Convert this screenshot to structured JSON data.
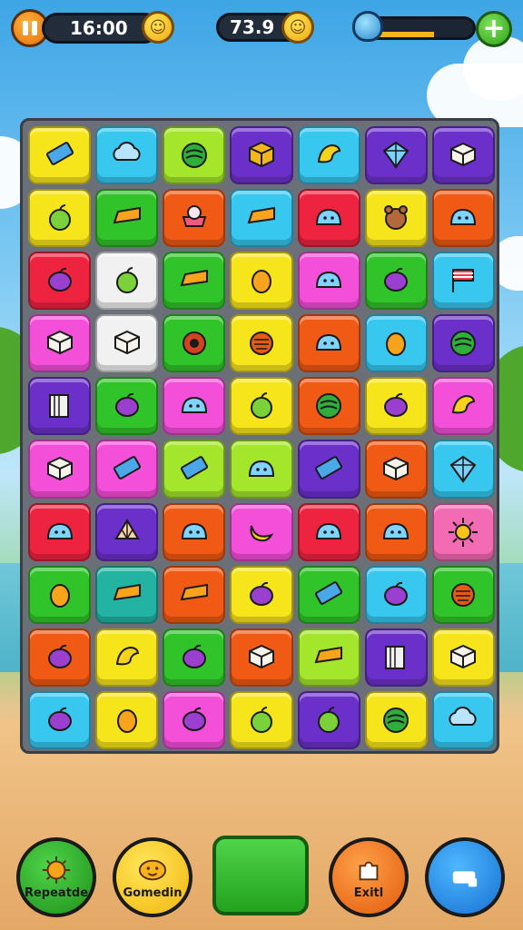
{
  "hud": {
    "time": "16:00",
    "score": "73.9",
    "progress_fraction": 0.62,
    "add_label": "+"
  },
  "colors": {
    "red": "#ee2340",
    "orange": "#f05a14",
    "yellow": "#f7e51b",
    "lime": "#a3e62b",
    "green": "#31c42a",
    "cyan": "#38c7ee",
    "purple": "#6b30c9",
    "magenta": "#f34fd9",
    "pink": "#f26bb3",
    "teal": "#22b3a2",
    "white": "#f1f1f1",
    "pale": "#fbe48a"
  },
  "board": {
    "rows": [
      [
        {
          "bg": "yellow",
          "icon": "chip-icon"
        },
        {
          "bg": "cyan",
          "icon": "cloud-icon"
        },
        {
          "bg": "lime",
          "icon": "melon-icon"
        },
        {
          "bg": "purple",
          "icon": "cube-icon"
        },
        {
          "bg": "cyan",
          "icon": "bird-icon"
        },
        {
          "bg": "purple",
          "icon": "crystal-icon"
        },
        {
          "bg": "purple",
          "icon": "box-icon"
        }
      ],
      [
        {
          "bg": "yellow",
          "icon": "apple-icon"
        },
        {
          "bg": "green",
          "icon": "cheese-icon"
        },
        {
          "bg": "orange",
          "icon": "cake-icon"
        },
        {
          "bg": "cyan",
          "icon": "cheese-icon"
        },
        {
          "bg": "red",
          "icon": "slime-icon"
        },
        {
          "bg": "yellow",
          "icon": "bear-icon"
        },
        {
          "bg": "orange",
          "icon": "slime-icon"
        }
      ],
      [
        {
          "bg": "red",
          "icon": "plum-icon"
        },
        {
          "bg": "white",
          "icon": "apple-icon"
        },
        {
          "bg": "green",
          "icon": "cheese-icon"
        },
        {
          "bg": "yellow",
          "icon": "lemon-icon"
        },
        {
          "bg": "magenta",
          "icon": "slime-icon"
        },
        {
          "bg": "green",
          "icon": "plum-icon"
        },
        {
          "bg": "cyan",
          "icon": "flag-icon"
        }
      ],
      [
        {
          "bg": "magenta",
          "icon": "box-icon"
        },
        {
          "bg": "white",
          "icon": "box-icon"
        },
        {
          "bg": "green",
          "icon": "seed-icon"
        },
        {
          "bg": "yellow",
          "icon": "berry-icon"
        },
        {
          "bg": "orange",
          "icon": "slime-icon"
        },
        {
          "bg": "cyan",
          "icon": "lemon-icon"
        },
        {
          "bg": "purple",
          "icon": "melon-icon"
        }
      ],
      [
        {
          "bg": "purple",
          "icon": "book-icon"
        },
        {
          "bg": "green",
          "icon": "plum-icon"
        },
        {
          "bg": "magenta",
          "icon": "slime-icon"
        },
        {
          "bg": "yellow",
          "icon": "apple-icon"
        },
        {
          "bg": "orange",
          "icon": "melon-icon"
        },
        {
          "bg": "yellow",
          "icon": "plum-icon"
        },
        {
          "bg": "magenta",
          "icon": "bird-icon"
        }
      ],
      [
        {
          "bg": "magenta",
          "icon": "box-icon"
        },
        {
          "bg": "magenta",
          "icon": "chip-icon"
        },
        {
          "bg": "lime",
          "icon": "chip-icon"
        },
        {
          "bg": "lime",
          "icon": "slime-icon"
        },
        {
          "bg": "purple",
          "icon": "chip-icon"
        },
        {
          "bg": "orange",
          "icon": "box-icon"
        },
        {
          "bg": "cyan",
          "icon": "crystal-icon"
        }
      ],
      [
        {
          "bg": "red",
          "icon": "slime-icon"
        },
        {
          "bg": "purple",
          "icon": "shell-icon"
        },
        {
          "bg": "orange",
          "icon": "slime-icon"
        },
        {
          "bg": "magenta",
          "icon": "banana-icon"
        },
        {
          "bg": "red",
          "icon": "slime-icon"
        },
        {
          "bg": "orange",
          "icon": "slime-icon"
        },
        {
          "bg": "pink",
          "icon": "sun-icon"
        }
      ],
      [
        {
          "bg": "green",
          "icon": "lemon-icon"
        },
        {
          "bg": "teal",
          "icon": "cheese-icon"
        },
        {
          "bg": "orange",
          "icon": "cheese-icon"
        },
        {
          "bg": "yellow",
          "icon": "plum-icon"
        },
        {
          "bg": "green",
          "icon": "chip-icon"
        },
        {
          "bg": "cyan",
          "icon": "plum-icon"
        },
        {
          "bg": "green",
          "icon": "berry-icon"
        }
      ],
      [
        {
          "bg": "orange",
          "icon": "plum-icon"
        },
        {
          "bg": "yellow",
          "icon": "bird-icon"
        },
        {
          "bg": "green",
          "icon": "plum-icon"
        },
        {
          "bg": "orange",
          "icon": "box-icon"
        },
        {
          "bg": "lime",
          "icon": "cheese-icon"
        },
        {
          "bg": "purple",
          "icon": "book-icon"
        },
        {
          "bg": "yellow",
          "icon": "box-icon"
        }
      ],
      [
        {
          "bg": "cyan",
          "icon": "plum-icon"
        },
        {
          "bg": "yellow",
          "icon": "lemon-icon"
        },
        {
          "bg": "magenta",
          "icon": "plum-icon"
        },
        {
          "bg": "yellow",
          "icon": "apple-icon"
        },
        {
          "bg": "purple",
          "icon": "apple-icon"
        },
        {
          "bg": "yellow",
          "icon": "melon-icon"
        },
        {
          "bg": "cyan",
          "icon": "cloud-icon"
        }
      ]
    ]
  },
  "buttons": {
    "repeat_label": "Repeatde",
    "gomedin_label": "Gomedin",
    "exit_label": "Exitl"
  }
}
